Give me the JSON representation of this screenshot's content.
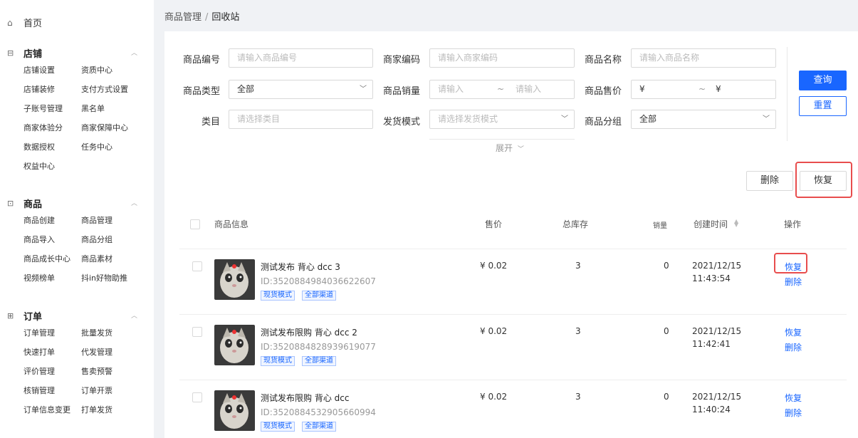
{
  "breadcrumb": {
    "parent": "商品管理",
    "separator": "/",
    "current": "回收站"
  },
  "sidebar": {
    "home": "首页",
    "sections": [
      {
        "title": "店铺",
        "icon": "shop-icon",
        "items": [
          "店铺设置",
          "资质中心",
          "店铺装修",
          "支付方式设置",
          "子账号管理",
          "黑名单",
          "商家体验分",
          "商家保障中心",
          "数据授权",
          "任务中心",
          "权益中心"
        ]
      },
      {
        "title": "商品",
        "icon": "lock-icon",
        "items": [
          "商品创建",
          "商品管理",
          "商品导入",
          "商品分组",
          "商品成长中心",
          "商品素材",
          "视频榜单",
          "抖in好物助推"
        ]
      },
      {
        "title": "订单",
        "icon": "clipboard-icon",
        "items": [
          "订单管理",
          "批量发货",
          "快速打单",
          "代发管理",
          "评价管理",
          "售卖预警",
          "核销管理",
          "订单开票",
          "订单信息变更",
          "打单发货"
        ]
      }
    ]
  },
  "filters": {
    "product_no": {
      "label": "商品编号",
      "placeholder": "请输入商品编号"
    },
    "merchant_code": {
      "label": "商家编码",
      "placeholder": "请输入商家编码"
    },
    "product_name": {
      "label": "商品名称",
      "placeholder": "请输入商品名称"
    },
    "product_type": {
      "label": "商品类型",
      "value": "全部"
    },
    "sales": {
      "label": "商品销量",
      "min_placeholder": "请输入",
      "tilde": "~",
      "max_placeholder": "请输入"
    },
    "price": {
      "label": "商品售价",
      "min_prefix": "¥",
      "tilde": "~",
      "max_prefix": "¥"
    },
    "category": {
      "label": "类目",
      "placeholder": "请选择类目"
    },
    "ship_mode": {
      "label": "发货模式",
      "placeholder": "请选择发货模式"
    },
    "group": {
      "label": "商品分组",
      "value": "全部"
    },
    "expand": "展开"
  },
  "actions": {
    "query": "查询",
    "reset": "重置",
    "delete": "删除",
    "restore": "恢复"
  },
  "table": {
    "headers": {
      "info": "商品信息",
      "price": "售价",
      "stock": "总库存",
      "sales": "销量",
      "created": "创建时间",
      "ops": "操作"
    },
    "rows": [
      {
        "name": "测试发布 背心 dcc 3",
        "id": "ID:3520884984036622607",
        "tags": [
          "现货模式",
          "全部渠道"
        ],
        "price": "¥ 0.02",
        "stock": "3",
        "sales": "0",
        "date": "2021/12/15",
        "time": "11:43:54",
        "restore": "恢复",
        "delete": "删除"
      },
      {
        "name": "测试发布限购 背心 dcc 2",
        "id": "ID:3520884828939619077",
        "tags": [
          "现货模式",
          "全部渠道"
        ],
        "price": "¥ 0.02",
        "stock": "3",
        "sales": "0",
        "date": "2021/12/15",
        "time": "11:42:41",
        "restore": "恢复",
        "delete": "删除"
      },
      {
        "name": "测试发布限购 背心 dcc",
        "id": "ID:3520884532905660994",
        "tags": [
          "现货模式",
          "全部渠道"
        ],
        "price": "¥ 0.02",
        "stock": "3",
        "sales": "0",
        "date": "2021/12/15",
        "time": "11:40:24",
        "restore": "恢复",
        "delete": "删除"
      }
    ]
  },
  "colors": {
    "primary": "#1966ff",
    "highlight": "#e84d4d"
  }
}
